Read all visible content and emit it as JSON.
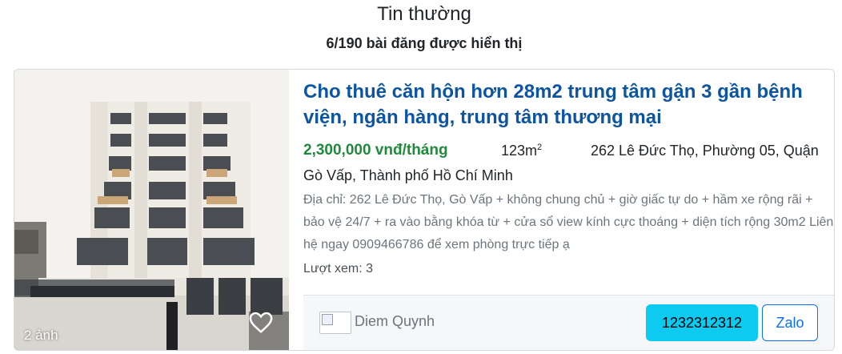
{
  "section": {
    "title": "Tin thường",
    "count_text": "6/190 bài đăng được hiển thị"
  },
  "listing": {
    "title": "Cho thuê căn hộn hơn 28m2 trung tâm gận 3 gần bệnh viện, ngân hàng, trung tâm thương mại",
    "price": "2,300,000 vnđ/tháng",
    "area_value": "123m",
    "area_unit_sup": "2",
    "address_line1": "262 Lê Đức Thọ, Phường 05, Quận",
    "address_line2": "Gò Vấp, Thành phố Hồ Chí Minh",
    "description": "Địa chỉ: 262 Lê Đức Thọ, Gò Vấp + không chung chủ + giờ giấc tự do + hầm xe rộng rãi + bảo vệ 24/7 + ra vào bằng khóa từ + cửa sổ view kính cực thoáng + diện tích rộng 30m2 Liên hệ ngay 0909466786 để xem phòng trực tiếp ạ",
    "views": "Lượt xem: 3",
    "photo_count": "2 ảnh"
  },
  "agent": {
    "name": "Diem Quynh",
    "phone_label": "1232312312",
    "zalo_label": "Zalo"
  },
  "icons": {
    "favorite": "heart-outline-icon",
    "avatar": "broken-image-icon"
  },
  "colors": {
    "title": "#0d55a0",
    "price": "#1f8a3b",
    "phone_button": "#0dcaf0",
    "zalo_border": "#0d6efd"
  }
}
